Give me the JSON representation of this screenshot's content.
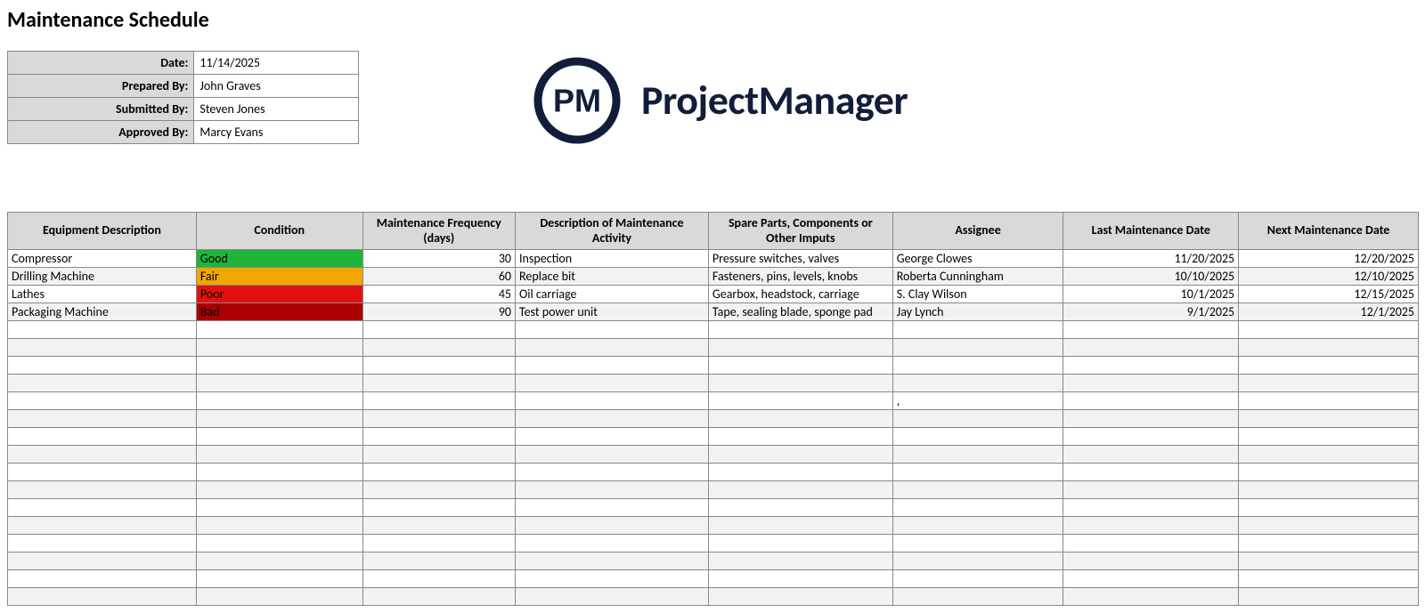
{
  "title": "Maintenance Schedule",
  "meta": {
    "date_label": "Date:",
    "date_value": "11/14/2025",
    "prepared_label": "Prepared By:",
    "prepared_value": "John Graves",
    "submitted_label": "Submitted By:",
    "submitted_value": "Steven Jones",
    "approved_label": "Approved By:",
    "approved_value": "Marcy Evans"
  },
  "brand": {
    "logo_initials": "PM",
    "name": "ProjectManager",
    "color": "#121d3b"
  },
  "columns": [
    "Equipment Description",
    "Condition",
    "Maintenance Frequency (days)",
    "Description of Maintenance Activity",
    "Spare Parts, Components or Other Imputs",
    "Assignee",
    "Last Maintenance Date",
    "Next Maintenance Date"
  ],
  "condition_colors": {
    "Good": "#1eb53a",
    "Fair": "#f1a700",
    "Poor": "#e31010",
    "Bad": "#aa0000"
  },
  "rows": [
    {
      "equipment": "Compressor",
      "condition": "Good",
      "frequency": "30",
      "activity": "Inspection",
      "parts": "Pressure switches, valves",
      "assignee": "George Clowes",
      "last": "11/20/2025",
      "next": "12/20/2025"
    },
    {
      "equipment": "Drilling Machine",
      "condition": "Fair",
      "frequency": "60",
      "activity": "Replace bit",
      "parts": "Fasteners, pins, levels, knobs",
      "assignee": "Roberta Cunningham",
      "last": "10/10/2025",
      "next": "12/10/2025"
    },
    {
      "equipment": "Lathes",
      "condition": "Poor",
      "frequency": "45",
      "activity": "Oil carriage",
      "parts": "Gearbox, headstock, carriage",
      "assignee": "S. Clay Wilson",
      "last": "10/1/2025",
      "next": "12/15/2025"
    },
    {
      "equipment": "Packaging Machine",
      "condition": "Bad",
      "frequency": "90",
      "activity": "Test power unit",
      "parts": "Tape, sealing blade, sponge pad",
      "assignee": "Jay Lynch",
      "last": "9/1/2025",
      "next": "12/1/2025"
    },
    {
      "equipment": "",
      "condition": "",
      "frequency": "",
      "activity": "",
      "parts": "",
      "assignee": "",
      "last": "",
      "next": ""
    },
    {
      "equipment": "",
      "condition": "",
      "frequency": "",
      "activity": "",
      "parts": "",
      "assignee": "",
      "last": "",
      "next": ""
    },
    {
      "equipment": "",
      "condition": "",
      "frequency": "",
      "activity": "",
      "parts": "",
      "assignee": "",
      "last": "",
      "next": ""
    },
    {
      "equipment": "",
      "condition": "",
      "frequency": "",
      "activity": "",
      "parts": "",
      "assignee": "",
      "last": "",
      "next": ""
    },
    {
      "equipment": "",
      "condition": "",
      "frequency": "",
      "activity": "",
      "parts": "",
      "assignee": ",",
      "last": "",
      "next": ""
    },
    {
      "equipment": "",
      "condition": "",
      "frequency": "",
      "activity": "",
      "parts": "",
      "assignee": "",
      "last": "",
      "next": ""
    },
    {
      "equipment": "",
      "condition": "",
      "frequency": "",
      "activity": "",
      "parts": "",
      "assignee": "",
      "last": "",
      "next": ""
    },
    {
      "equipment": "",
      "condition": "",
      "frequency": "",
      "activity": "",
      "parts": "",
      "assignee": "",
      "last": "",
      "next": ""
    },
    {
      "equipment": "",
      "condition": "",
      "frequency": "",
      "activity": "",
      "parts": "",
      "assignee": "",
      "last": "",
      "next": ""
    },
    {
      "equipment": "",
      "condition": "",
      "frequency": "",
      "activity": "",
      "parts": "",
      "assignee": "",
      "last": "",
      "next": ""
    },
    {
      "equipment": "",
      "condition": "",
      "frequency": "",
      "activity": "",
      "parts": "",
      "assignee": "",
      "last": "",
      "next": ""
    },
    {
      "equipment": "",
      "condition": "",
      "frequency": "",
      "activity": "",
      "parts": "",
      "assignee": "",
      "last": "",
      "next": ""
    },
    {
      "equipment": "",
      "condition": "",
      "frequency": "",
      "activity": "",
      "parts": "",
      "assignee": "",
      "last": "",
      "next": ""
    },
    {
      "equipment": "",
      "condition": "",
      "frequency": "",
      "activity": "",
      "parts": "",
      "assignee": "",
      "last": "",
      "next": ""
    },
    {
      "equipment": "",
      "condition": "",
      "frequency": "",
      "activity": "",
      "parts": "",
      "assignee": "",
      "last": "",
      "next": ""
    },
    {
      "equipment": "",
      "condition": "",
      "frequency": "",
      "activity": "",
      "parts": "",
      "assignee": "",
      "last": "",
      "next": ""
    }
  ]
}
